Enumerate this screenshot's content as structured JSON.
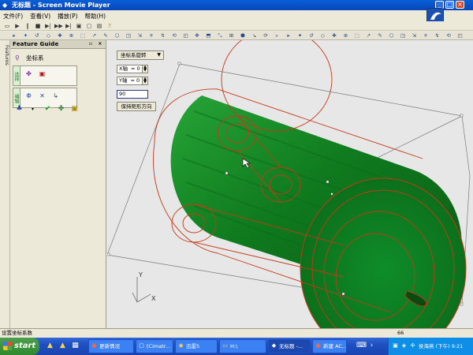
{
  "window": {
    "title": "无标题 - Screen Movie Player",
    "icon": "diamond-icon"
  },
  "menu": [
    "文件(F)",
    "查看(V)",
    "播放(P)",
    "帮助(H)"
  ],
  "panel": {
    "header": "Feature Guide",
    "side_tab": "Features",
    "feature_title": "坐标系",
    "group1_label": "选择",
    "group2_label": "编辑"
  },
  "viewport": {
    "dropdown": "坐标系旋转",
    "x_axis_label": "X轴",
    "x_axis_value": "= 0",
    "y_axis_label": "Y轴",
    "y_axis_value": "= 0",
    "angle_value": "90",
    "keep_button": "保持矩形方向",
    "axis_x": "X",
    "axis_y": "Y",
    "model_color": "#0f7a1e",
    "edge_color": "#c43a18"
  },
  "status": {
    "left": "设置坐标系数",
    "right": "66"
  },
  "taskbar": {
    "start": "start",
    "tasks": [
      "更新情况",
      "[Cimatr...",
      "迅雷5",
      "H:\\",
      "无标题 -...",
      "新建 AC..."
    ],
    "clock": "侯海燕 (下午) 9:21"
  }
}
